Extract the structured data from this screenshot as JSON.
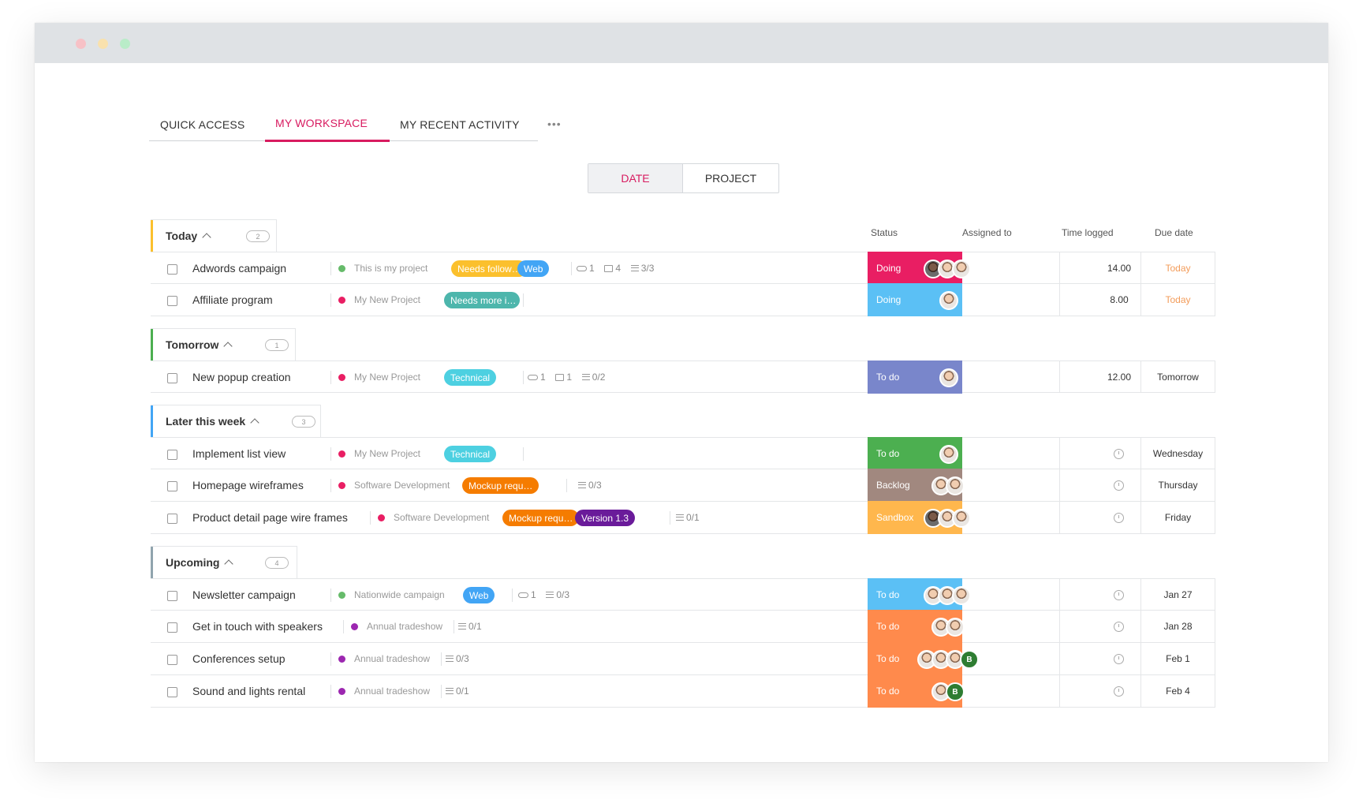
{
  "window": {
    "dots": [
      "#f7c1c6",
      "#f9e1ad",
      "#b9ecc8"
    ]
  },
  "tabs": {
    "quick_access": "QUICK ACCESS",
    "my_workspace": "MY WORKSPACE",
    "recent_activity": "MY RECENT ACTIVITY",
    "more": "•••"
  },
  "view_toggle": {
    "date": "DATE",
    "project": "PROJECT"
  },
  "columns": {
    "status": "Status",
    "assigned": "Assigned to",
    "time": "Time logged",
    "due": "Due date"
  },
  "sections": [
    {
      "title": "Today",
      "count": "2",
      "color": "#fbc02d",
      "tasks": [
        {
          "name": "Adwords campaign",
          "project": "This is my project",
          "project_color": "#66bb6a",
          "labels": [
            {
              "text": "Needs follow…",
              "color": "#fbc02d"
            },
            {
              "text": "Web",
              "color": "#42a5f5"
            }
          ],
          "attachments": "1",
          "comments": "4",
          "subtasks": "3/3",
          "status": "Doing",
          "status_color": "#e91e63",
          "assignees": 3,
          "time": "14.00",
          "due": "Today"
        },
        {
          "name": "Affiliate program",
          "project": "My New Project",
          "project_color": "#e91e63",
          "labels": [
            {
              "text": "Needs more i…",
              "color": "#4db6ac"
            }
          ],
          "status": "Doing",
          "status_color": "#5bc0f5",
          "assignees": 1,
          "time": "8.00",
          "due": "Today"
        }
      ]
    },
    {
      "title": "Tomorrow",
      "count": "1",
      "color": "#4caf50",
      "tasks": [
        {
          "name": "New popup creation",
          "project": "My New Project",
          "project_color": "#e91e63",
          "labels": [
            {
              "text": "Technical",
              "color": "#4dd0e1"
            }
          ],
          "attachments": "1",
          "comments": "1",
          "subtasks": "0/2",
          "status": "To do",
          "status_color": "#7986cb",
          "assignees": 1,
          "time": "12.00",
          "due": "Tomorrow"
        }
      ]
    },
    {
      "title": "Later this week",
      "count": "3",
      "color": "#42a5f5",
      "tasks": [
        {
          "name": "Implement list view",
          "project": "My New Project",
          "project_color": "#e91e63",
          "labels": [
            {
              "text": "Technical",
              "color": "#4dd0e1"
            }
          ],
          "status": "To do",
          "status_color": "#4caf50",
          "assignees": 1,
          "due": "Wednesday"
        },
        {
          "name": "Homepage wireframes",
          "project": "Software Development",
          "project_color": "#e91e63",
          "labels": [
            {
              "text": "Mockup requ…",
              "color": "#f57c00"
            }
          ],
          "subtasks": "0/3",
          "status": "Backlog",
          "status_color": "#a1887f",
          "assignees": 2,
          "due": "Thursday"
        },
        {
          "name": "Product detail page wire frames",
          "project": "Software Development",
          "project_color": "#e91e63",
          "labels": [
            {
              "text": "Mockup requ…",
              "color": "#f57c00"
            },
            {
              "text": "Version 1.3",
              "color": "#6a1b9a"
            }
          ],
          "subtasks": "0/1",
          "status": "Sandbox",
          "status_color": "#ffb74d",
          "assignees": 3,
          "due": "Friday"
        }
      ]
    },
    {
      "title": "Upcoming",
      "count": "4",
      "color": "#90a4ae",
      "tasks": [
        {
          "name": "Newsletter campaign",
          "project": "Nationwide campaign",
          "project_color": "#66bb6a",
          "labels": [
            {
              "text": "Web",
              "color": "#42a5f5"
            }
          ],
          "attachments": "1",
          "subtasks": "0/3",
          "status": "To do",
          "status_color": "#5bc0f5",
          "assignees": 3,
          "due": "Jan 27"
        },
        {
          "name": "Get in touch with speakers",
          "project": "Annual tradeshow",
          "project_color": "#9c27b0",
          "labels": [],
          "subtasks": "0/1",
          "status": "To do",
          "status_color": "#ff8a4c",
          "assignees": 2,
          "due": "Jan 28"
        },
        {
          "name": "Conferences setup",
          "project": "Annual tradeshow",
          "project_color": "#9c27b0",
          "labels": [],
          "subtasks": "0/3",
          "status": "To do",
          "status_color": "#ff8a4c",
          "assignees": 3,
          "badge": "B",
          "due": "Feb 1"
        },
        {
          "name": "Sound and lights rental",
          "project": "Annual tradeshow",
          "project_color": "#9c27b0",
          "labels": [],
          "subtasks": "0/1",
          "status": "To do",
          "status_color": "#ff8a4c",
          "assignees": 1,
          "badge": "B",
          "due": "Feb 4"
        }
      ]
    }
  ]
}
